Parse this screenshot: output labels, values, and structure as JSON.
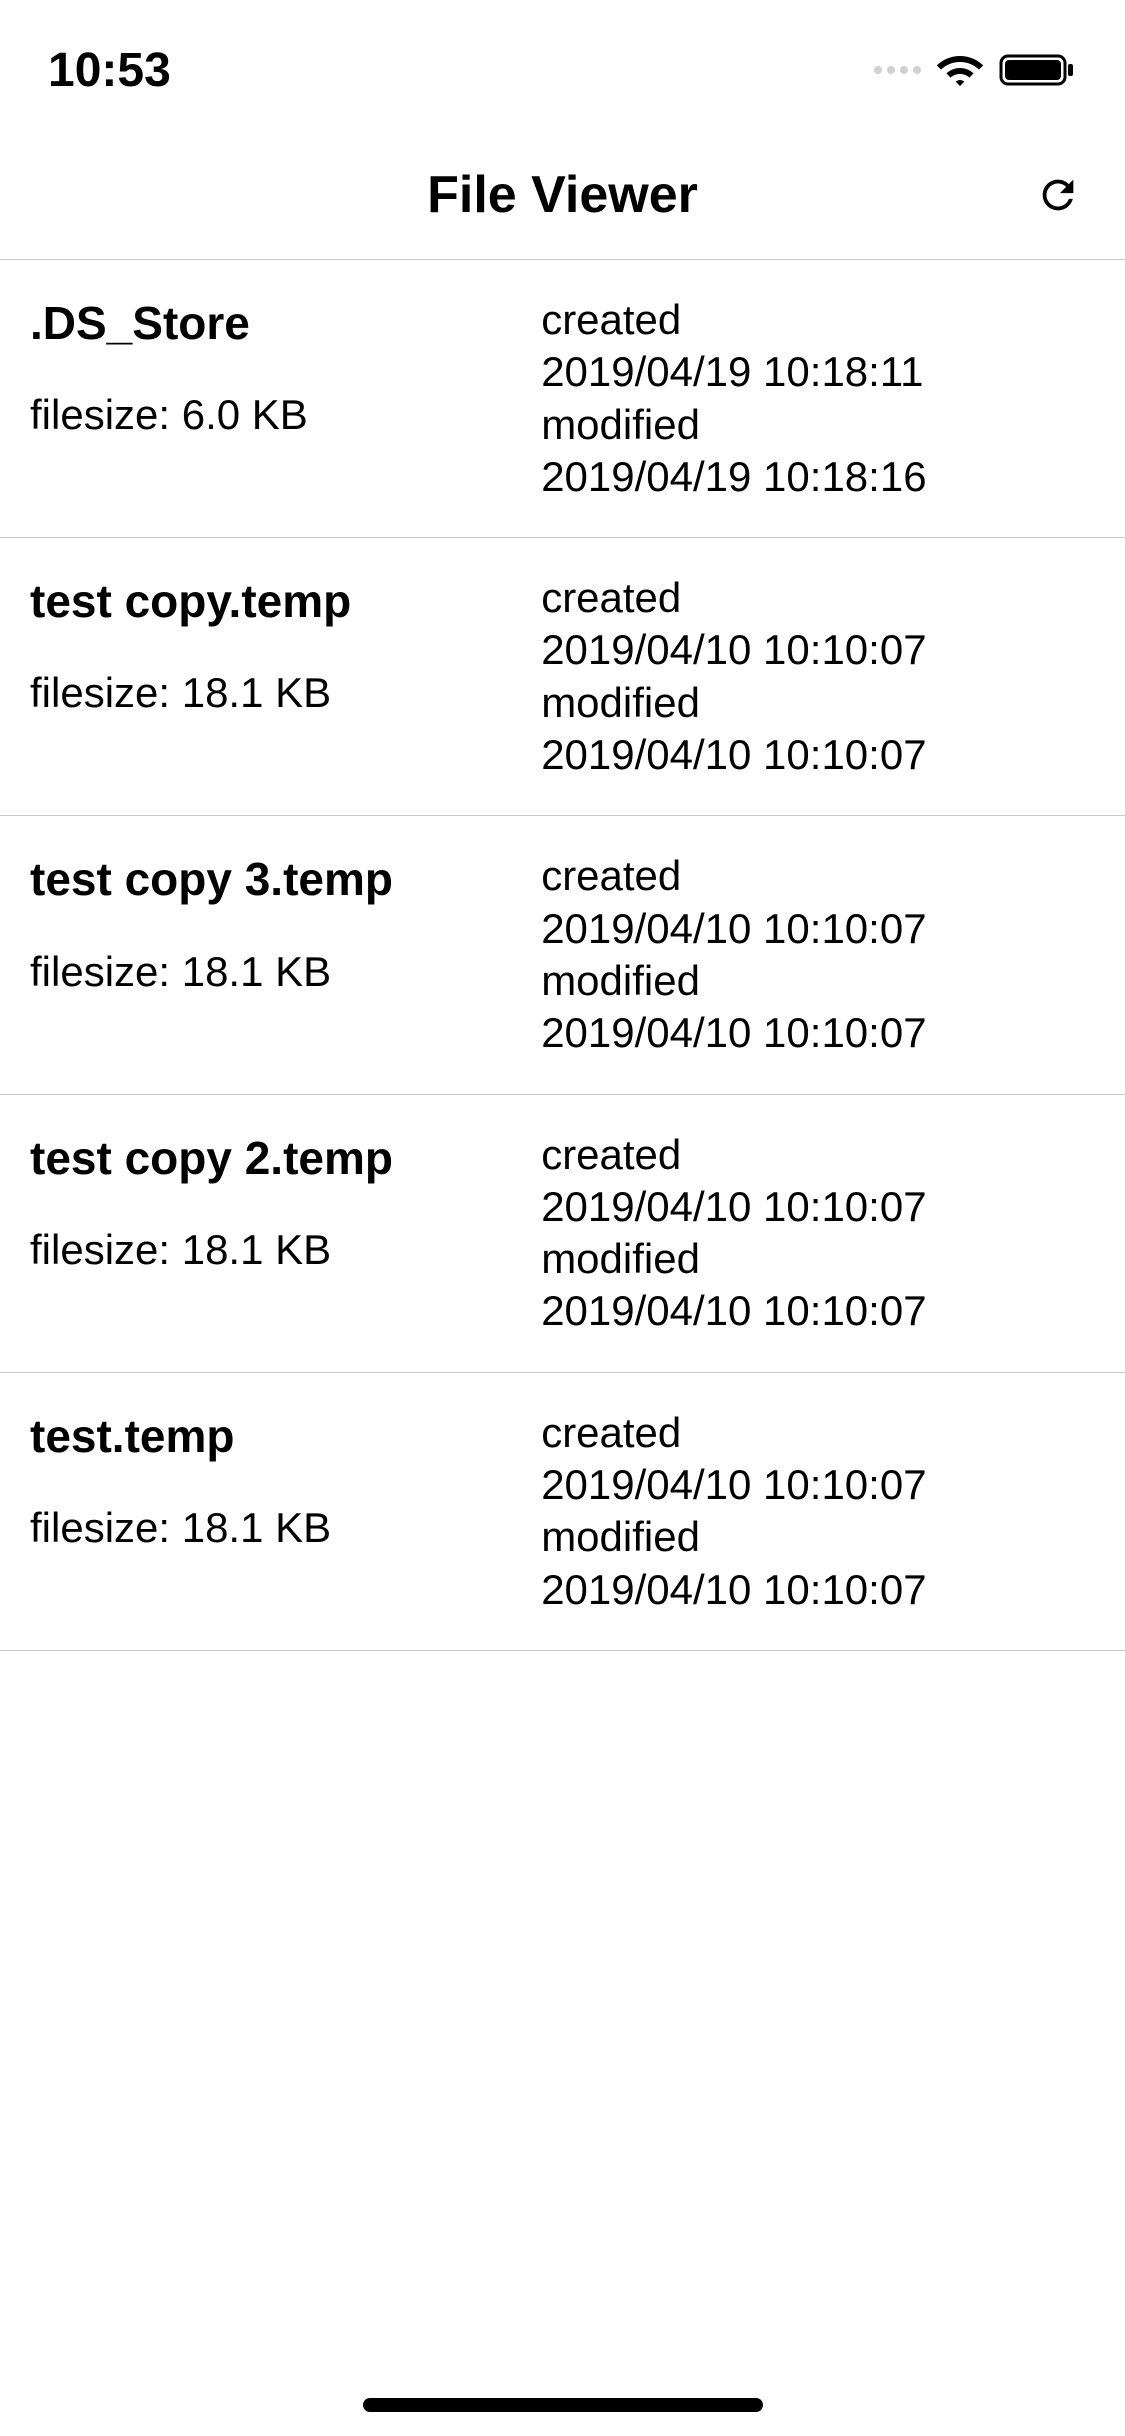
{
  "status_bar": {
    "time": "10:53"
  },
  "nav": {
    "title": "File Viewer"
  },
  "labels": {
    "filesize_prefix": "filesize: ",
    "created": "created",
    "modified": "modified"
  },
  "files": [
    {
      "name": ".DS_Store",
      "size": "6.0 KB",
      "created": "2019/04/19 10:18:11",
      "modified": "2019/04/19 10:18:16"
    },
    {
      "name": "test copy.temp",
      "size": "18.1 KB",
      "created": "2019/04/10 10:10:07",
      "modified": "2019/04/10 10:10:07"
    },
    {
      "name": "test copy 3.temp",
      "size": "18.1 KB",
      "created": "2019/04/10 10:10:07",
      "modified": "2019/04/10 10:10:07"
    },
    {
      "name": "test copy 2.temp",
      "size": "18.1 KB",
      "created": "2019/04/10 10:10:07",
      "modified": "2019/04/10 10:10:07"
    },
    {
      "name": "test.temp",
      "size": "18.1 KB",
      "created": "2019/04/10 10:10:07",
      "modified": "2019/04/10 10:10:07"
    }
  ]
}
